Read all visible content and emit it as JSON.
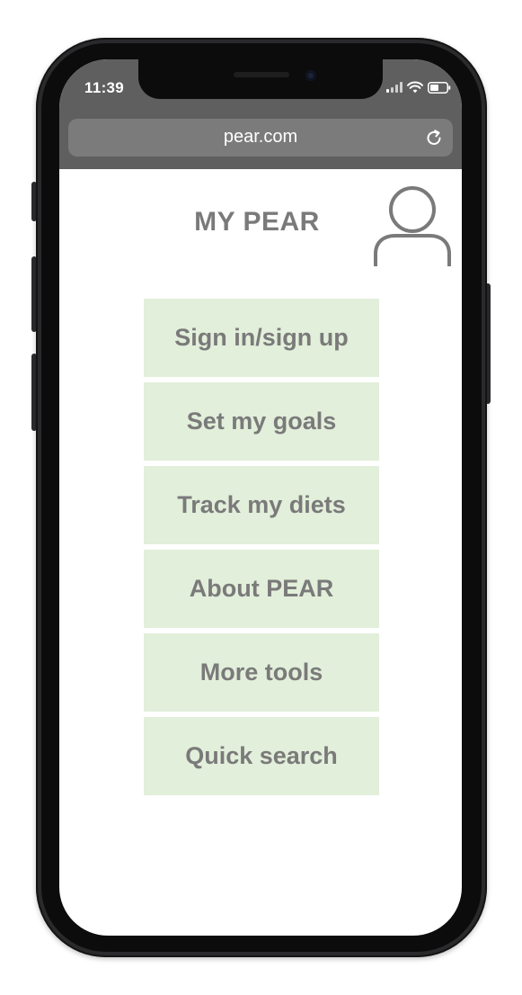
{
  "status_bar": {
    "time": "11:39",
    "icons": [
      "cellular-signal-icon",
      "wifi-icon",
      "battery-icon"
    ]
  },
  "browser": {
    "url": "pear.com",
    "reload_icon": "reload-icon"
  },
  "header": {
    "title": "MY PEAR",
    "avatar_icon": "user-profile-icon"
  },
  "menu": {
    "items": [
      {
        "label": "Sign in/sign up"
      },
      {
        "label": "Set my goals"
      },
      {
        "label": "Track my diets"
      },
      {
        "label": "About PEAR"
      },
      {
        "label": "More tools"
      },
      {
        "label": "Quick search"
      }
    ]
  },
  "colors": {
    "menu_background": "#e2efda",
    "text_gray": "#7a7a7a",
    "browser_bar": "#5f5f5f",
    "url_field": "#7b7b7b"
  }
}
